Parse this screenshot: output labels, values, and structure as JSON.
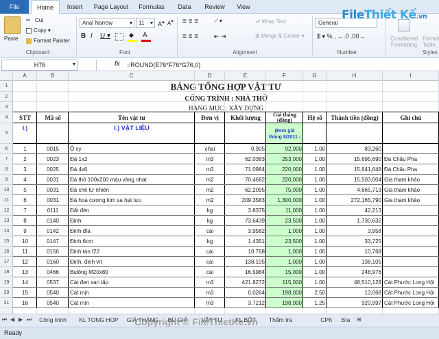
{
  "tabs": [
    "File",
    "Home",
    "Insert",
    "Page Layout",
    "Formulas",
    "Data",
    "Review",
    "View"
  ],
  "logo": {
    "main": "File",
    "rest": "Thiết Kế",
    "suffix": ".vn"
  },
  "ribbon": {
    "paste": "Paste",
    "cut": "Cut",
    "copy": "Copy",
    "format_painter": "Format Painter",
    "clipboard": "Clipboard",
    "font_name": "Arial Narrow",
    "font_size": "11",
    "font": "Font",
    "wrap_text": "Wrap Text",
    "merge_center": "Merge & Center",
    "alignment": "Alignment",
    "number_format": "General",
    "number": "Number",
    "conditional_formatting": "Conditional Formatting",
    "format_as_table": "Format as Table",
    "styles": "Styles"
  },
  "formula_bar": {
    "name_box": "H76",
    "fx": "fx",
    "formula": "=ROUND(E76*F76*G76,0)"
  },
  "columns": [
    "A",
    "B",
    "C",
    "D",
    "E",
    "F",
    "G",
    "H",
    "I"
  ],
  "row_numbers": [
    "1",
    "2",
    "3",
    "4",
    "5",
    "6",
    "7",
    "8",
    "9",
    "10",
    "11",
    "12",
    "13",
    "14",
    "15",
    "16",
    "17",
    "18",
    "19",
    "20",
    "21"
  ],
  "title": "BẢNG TỔNG HỢP VẬT TƯ",
  "project": "CÔNG TRÌNH : NHÀ THỜ",
  "category": "HẠNG MỤC : XÂY DỰNG",
  "headers": {
    "stt": "STT",
    "ma_so": "Mã số",
    "ten": "Tên vật tư",
    "don_vi": "Đơn vị",
    "khoi_luong": "Khối lượng",
    "gia_thang": "Giá tháng (đồng)",
    "he_so": "Hệ số",
    "thanh_tien": "Thành tiền (đồng)",
    "ghi_chu": "Ghi chú"
  },
  "section": {
    "stt": "I.)",
    "name": "I.) VẬT LIỆU",
    "note1": "(Đơn giá",
    "note2": "tháng 8/2011 -"
  },
  "rows": [
    [
      "1",
      "0015",
      "Ô xy",
      "chai",
      "0.905",
      "92,000",
      "1.00",
      "83,260",
      ""
    ],
    [
      "2",
      "0023",
      "Đá 1x2",
      "m3",
      "62.0383",
      "253,000",
      "1.00",
      "15,695,690",
      "Đá Châu Pha"
    ],
    [
      "3",
      "0025",
      "Đá 4x6",
      "m3",
      "71.0984",
      "220,000",
      "1.00",
      "15,641,648",
      "Đá Châu Pha"
    ],
    [
      "4",
      "0031",
      "Đá thô 100x200 màu vàng nhạt",
      "m2",
      "70.4682",
      "220,000",
      "1.00",
      "15,503,004",
      "Gia tham khảo"
    ],
    [
      "5",
      "0031",
      "Đá chẻ tự nhiên",
      "m2",
      "62.2095",
      "75,000",
      "1.00",
      "4,665,713",
      "Gia tham khảo"
    ],
    [
      "6",
      "0031",
      "Đá hoa cương kim sa hạt lựu",
      "m2",
      "209.3583",
      "1,300,000",
      "1.00",
      "272,165,790",
      "Gia tham khảo"
    ],
    [
      "7",
      "0111",
      "Đất đèn",
      "kg",
      "3.8375",
      "11,000",
      "1.00",
      "42,213",
      ""
    ],
    [
      "8",
      "0140",
      "Đinh",
      "kg",
      "73.6439",
      "23,500",
      "1.00",
      "1,730,632",
      ""
    ],
    [
      "9",
      "0142",
      "Đinh đĩa",
      "cái",
      "3.9582",
      "1,000",
      "1.00",
      "3,958",
      ""
    ],
    [
      "10",
      "0147",
      "Đinh 6cm",
      "kg",
      "1.4351",
      "23,500",
      "1.00",
      "33,725",
      ""
    ],
    [
      "11",
      "0156",
      "Đinh tán f22",
      "cái",
      "10.768",
      "1,000",
      "1.00",
      "10,768",
      ""
    ],
    [
      "12",
      "0160",
      "Đinh, đinh vít",
      "cái",
      "138.105",
      "1,000",
      "1.00",
      "138,105",
      ""
    ],
    [
      "13",
      "0466",
      "Bulông M20x80",
      "cái",
      "16.5984",
      "15,000",
      "1.00",
      "248,976",
      ""
    ],
    [
      "14",
      "0537",
      "Cát đen san lấp",
      "m3",
      "421.8272",
      "115,000",
      "1.00",
      "48,510,128",
      "Cát Phước Long Hội"
    ],
    [
      "15",
      "0540",
      "Cát mịn",
      "m3",
      "0.0264",
      "198,000",
      "2.50",
      "13,068",
      "Cát Phước Long Hội"
    ],
    [
      "16",
      "0540",
      "Cát mịn",
      "m3",
      "3.7212",
      "198,000",
      "1.25",
      "920,997",
      "Cát Phước Long Hội"
    ]
  ],
  "sheets": [
    "Công trình",
    "KL TONG HOP",
    "GIÁ THÁNG",
    "BÙ GIÁ",
    "VẬT TƯ",
    "KL BỘT VỮA",
    "Thẩm tra",
    "CPK",
    "Bìa"
  ],
  "status": "Ready",
  "watermark": "Copyright © FileThietKe.vn",
  "colors": {
    "accent": "#2b6cb5",
    "green_cell": "#ccffcc",
    "blue_text": "#2a3acb"
  }
}
